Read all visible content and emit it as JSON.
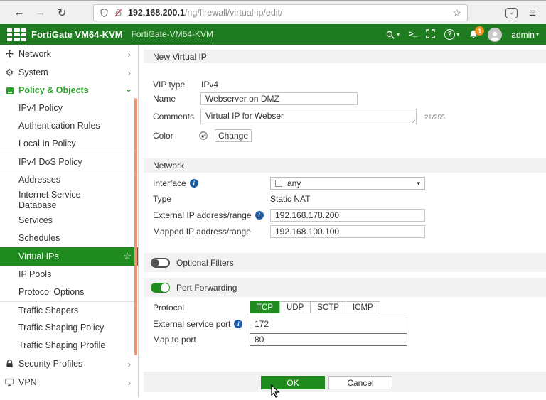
{
  "browser": {
    "url_host": "192.168.200.1",
    "url_path": "/ng/firewall/virtual-ip/edit/"
  },
  "header": {
    "brand": "FortiGate VM64-KVM",
    "hostname": "FortiGate-VM64-KVM",
    "notification_count": "1",
    "user_label": "admin"
  },
  "sidebar": {
    "items": [
      {
        "label": "Network"
      },
      {
        "label": "System"
      },
      {
        "label": "Policy & Objects"
      },
      {
        "label": "IPv4 Policy"
      },
      {
        "label": "Authentication Rules"
      },
      {
        "label": "Local In Policy"
      },
      {
        "label": "IPv4 DoS Policy"
      },
      {
        "label": "Addresses"
      },
      {
        "label": "Internet Service Database"
      },
      {
        "label": "Services"
      },
      {
        "label": "Schedules"
      },
      {
        "label": "Virtual IPs"
      },
      {
        "label": "IP Pools"
      },
      {
        "label": "Protocol Options"
      },
      {
        "label": "Traffic Shapers"
      },
      {
        "label": "Traffic Shaping Policy"
      },
      {
        "label": "Traffic Shaping Profile"
      },
      {
        "label": "Security Profiles"
      },
      {
        "label": "VPN"
      }
    ]
  },
  "form": {
    "title": "New Virtual IP",
    "vip_type_label": "VIP type",
    "vip_type_value": "IPv4",
    "name_label": "Name",
    "name_value": "Webserver on DMZ",
    "comments_label": "Comments",
    "comments_value": "Virtual IP for Webser",
    "comments_counter": "21/255",
    "color_label": "Color",
    "color_change_label": "Change",
    "network_section_title": "Network",
    "interface_label": "Interface",
    "interface_value": "any",
    "type_label": "Type",
    "type_value": "Static NAT",
    "external_ip_label": "External IP address/range",
    "external_ip_value": "192.168.178.200",
    "mapped_ip_label": "Mapped IP address/range",
    "mapped_ip_value": "192.168.100.100",
    "optional_filters_label": "Optional Filters",
    "port_forwarding_label": "Port Forwarding",
    "protocol_label": "Protocol",
    "protocols": [
      "TCP",
      "UDP",
      "SCTP",
      "ICMP"
    ],
    "protocol_selected": "TCP",
    "external_service_port_label": "External service port",
    "external_service_port_value": "172",
    "map_to_port_label": "Map to port",
    "map_to_port_value": "80",
    "ok_label": "OK",
    "cancel_label": "Cancel"
  },
  "icons": {
    "back": "←",
    "forward": "→",
    "reload": "↻",
    "star": "☆",
    "hamburger": "≡",
    "terminal": ">_",
    "caret_down": "▾",
    "chevron_right": "›",
    "help": "?",
    "info": "i"
  },
  "colors": {
    "header_green": "#1f7b1f",
    "accent_green": "#208c20",
    "menu_green": "#2ba22b",
    "scrollbar_orange": "#f1936c",
    "badge_orange": "#f0941f",
    "info_blue": "#1d5ca5",
    "section_bar_gray": "#f2f2f2"
  }
}
